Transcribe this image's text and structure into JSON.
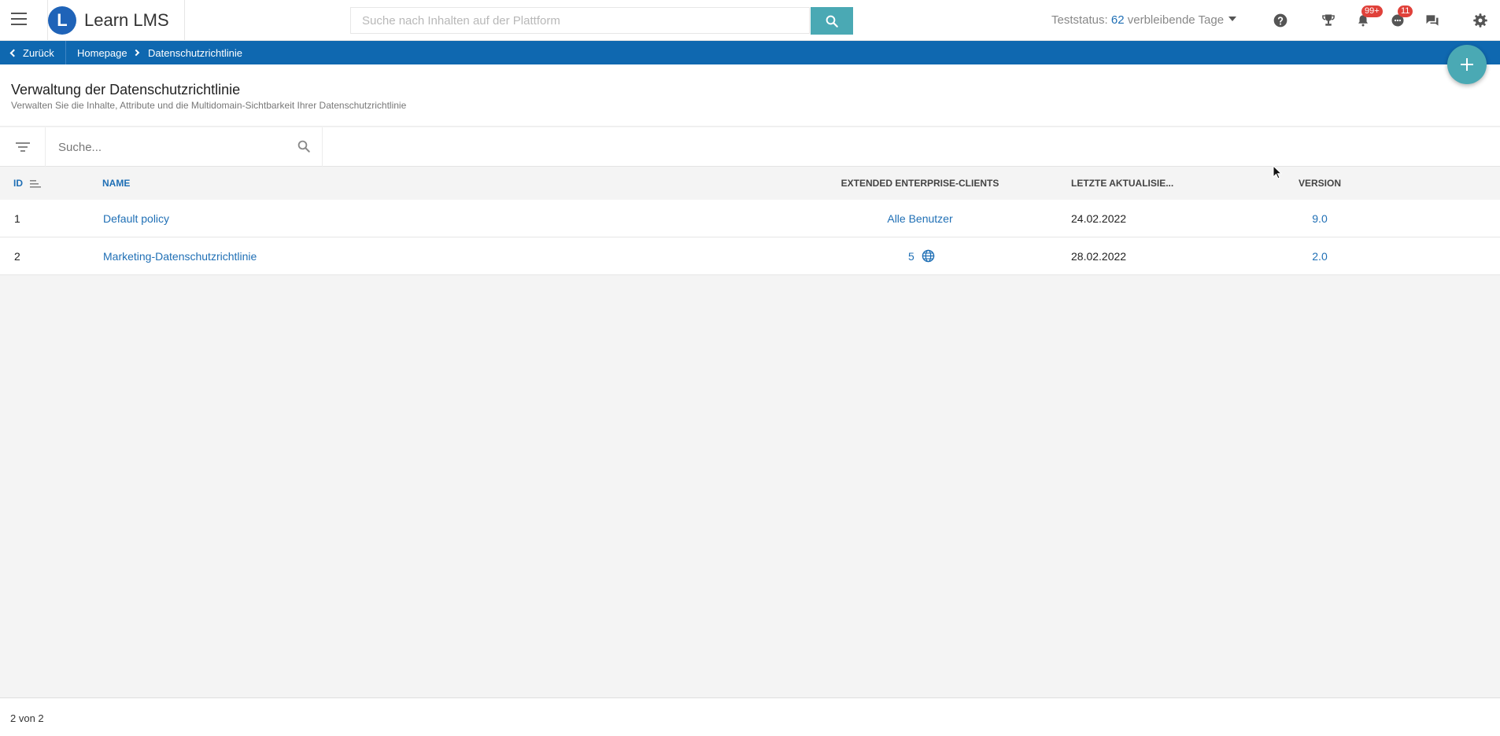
{
  "header": {
    "brand": "Learn LMS",
    "logo_letter": "L",
    "search_placeholder": "Suche nach Inhalten auf der Plattform",
    "trial_prefix": "Teststatus:",
    "trial_days": "62",
    "trial_suffix": "verbleibende Tage",
    "notifications_badge": "99+",
    "messages_badge": "11"
  },
  "breadcrumb": {
    "back": "Zurück",
    "home": "Homepage",
    "current": "Datenschutzrichtlinie"
  },
  "page": {
    "title": "Verwaltung der Datenschutzrichtlinie",
    "subtitle": "Verwalten Sie die Inhalte, Attribute und die Multidomain-Sichtbarkeit Ihrer Datenschutzrichtlinie"
  },
  "table": {
    "search_placeholder": "Suche...",
    "columns": {
      "id": "ID",
      "name": "NAME",
      "clients": "EXTENDED ENTERPRISE-CLIENTS",
      "updated": "LETZTE AKTUALISIE...",
      "version": "VERSION"
    },
    "rows": [
      {
        "id": "1",
        "name": "Default policy",
        "clients": "Alle Benutzer",
        "updated": "24.02.2022",
        "version": "9.0"
      },
      {
        "id": "2",
        "name": "Marketing-Datenschutzrichtlinie",
        "clients": "5",
        "updated": "28.02.2022",
        "version": "2.0"
      }
    ]
  },
  "footer": {
    "count": "2 von 2"
  },
  "colors": {
    "accent": "#4aa9b4",
    "primary": "#0f68b0",
    "link": "#1f6fb5",
    "badge": "#e0413a"
  }
}
